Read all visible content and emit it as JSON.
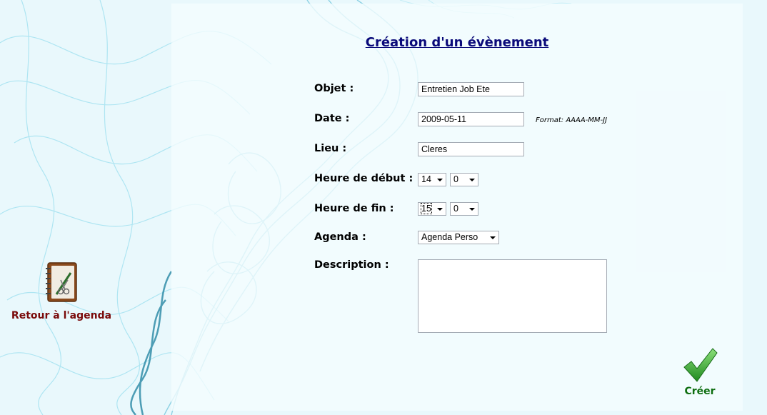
{
  "page": {
    "title": "Création d'un évènement"
  },
  "form": {
    "objet": {
      "label": "Objet :",
      "value": "Entretien Job Ete"
    },
    "date": {
      "label": "Date :",
      "value": "2009-05-11",
      "hint": "Format: AAAA-MM-JJ"
    },
    "lieu": {
      "label": "Lieu :",
      "value": "Cleres"
    },
    "heure_debut": {
      "label": "Heure de début :",
      "hour": "14",
      "minute": "0"
    },
    "heure_fin": {
      "label": "Heure de fin :",
      "hour": "15",
      "minute": "0"
    },
    "agenda": {
      "label": "Agenda :",
      "selected": "Agenda Perso"
    },
    "description": {
      "label": "Description :",
      "value": ""
    }
  },
  "actions": {
    "back_label": "Retour à l'agenda",
    "back_icon": "agenda-book-icon",
    "create_label": "Créer",
    "create_icon": "green-checkmark-icon"
  },
  "colors": {
    "title": "#0a0a7a",
    "back_label": "#7a0a0a",
    "create_label": "#0e6e10",
    "background": "#e9f8fc"
  }
}
